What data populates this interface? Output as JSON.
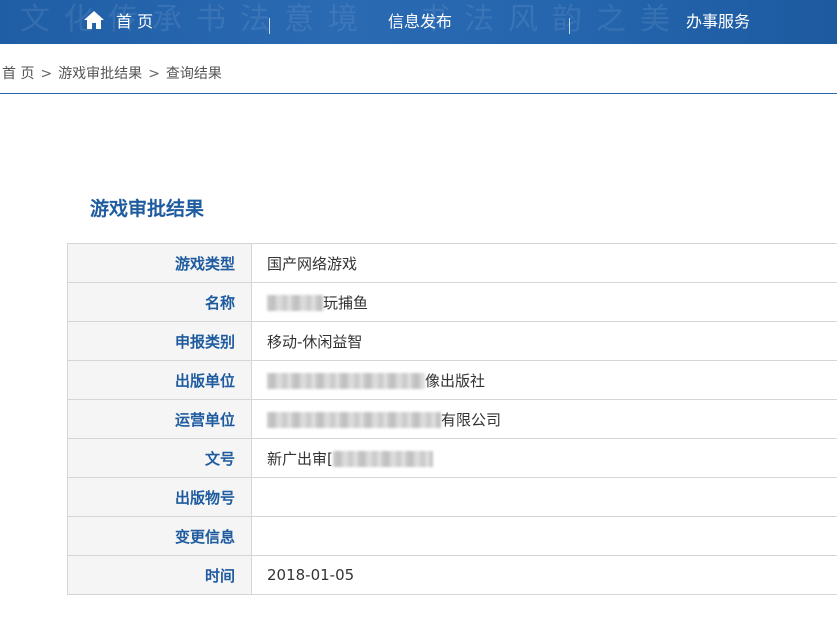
{
  "nav": {
    "home_label": "首 页",
    "info_label": "信息发布",
    "service_label": "办事服务",
    "home_icon": "home-icon"
  },
  "breadcrumb": {
    "items": [
      "首 页",
      "游戏审批结果",
      "查询结果"
    ],
    "separator": ">"
  },
  "page": {
    "title": "游戏审批结果"
  },
  "table": {
    "rows": [
      {
        "label": "游戏类型",
        "value": "国产网络游戏",
        "redacted": false
      },
      {
        "label": "名称",
        "value": "玩捕鱼",
        "redacted": true
      },
      {
        "label": "申报类别",
        "value": "移动-休闲益智",
        "redacted": false
      },
      {
        "label": "出版单位",
        "value": "像出版社",
        "redacted": true
      },
      {
        "label": "运营单位",
        "value": "有限公司",
        "redacted": true
      },
      {
        "label": "文号",
        "value": "新广出审[",
        "redacted": true
      },
      {
        "label": "出版物号",
        "value": "",
        "redacted": false
      },
      {
        "label": "变更信息",
        "value": "",
        "redacted": false
      },
      {
        "label": "时间",
        "value": "2018-01-05",
        "redacted": false
      }
    ]
  },
  "colors": {
    "nav_bg": "#2465ad",
    "accent": "#1e5b9f",
    "label_bg": "#f5f5f5",
    "border": "#d6d6d6"
  }
}
